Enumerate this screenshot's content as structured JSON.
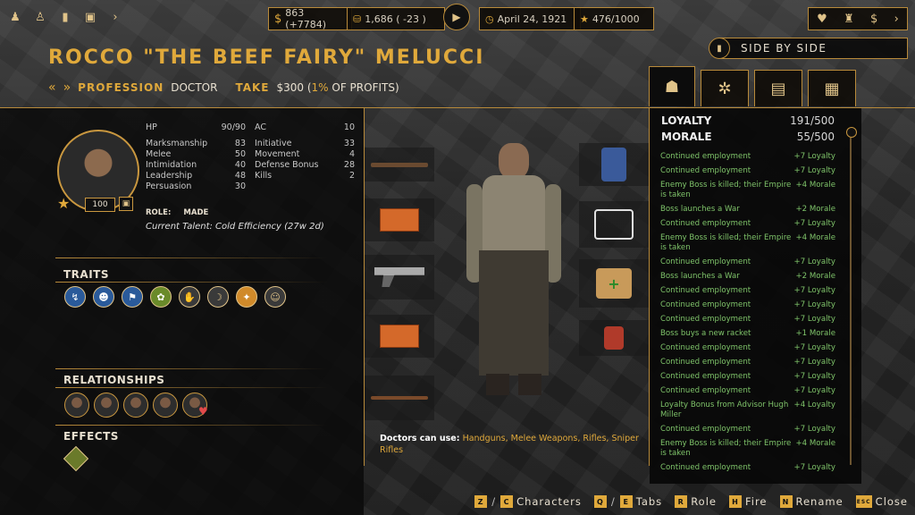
{
  "topbar": {
    "money": "863 (+7784)",
    "gang": "1,686 ( -23 )",
    "date": "April 24, 1921",
    "heat": "476/1000"
  },
  "side_by_side": "SIDE BY SIDE",
  "character": {
    "name": "ROCCO \"THE BEEF FAIRY\" MELUCCI",
    "profession_label": "PROFESSION",
    "profession": "DOCTOR",
    "take_label": "TAKE",
    "take_pre": "$300 (",
    "take_pct": "1%",
    "take_post": " OF PROFITS)",
    "level": "100",
    "role_label": "ROLE:",
    "role": "MADE",
    "talent": "Current Talent: Cold Efficiency (27w 2d)"
  },
  "stats_left": [
    {
      "label": "HP",
      "value": "90/90"
    },
    {
      "label": "Marksmanship",
      "value": "83"
    },
    {
      "label": "Melee",
      "value": "50"
    },
    {
      "label": "Intimidation",
      "value": "40"
    },
    {
      "label": "Leadership",
      "value": "48"
    },
    {
      "label": "Persuasion",
      "value": "30"
    }
  ],
  "stats_right": [
    {
      "label": "AC",
      "value": "10"
    },
    {
      "label": "Initiative",
      "value": "33"
    },
    {
      "label": "Movement",
      "value": "4"
    },
    {
      "label": "Defense Bonus",
      "value": "28"
    },
    {
      "label": "Kills",
      "value": "2"
    }
  ],
  "sections": {
    "traits": "TRAITS",
    "relationships": "RELATIONSHIPS",
    "effects": "EFFECTS"
  },
  "weapons_note": {
    "bold": "Doctors can use:",
    "list": "Handguns, Melee Weapons, Rifles, Sniper Rifles"
  },
  "loyalty": {
    "label": "LOYALTY",
    "value": "191/500"
  },
  "morale": {
    "label": "MORALE",
    "value": "55/500"
  },
  "log": [
    {
      "t": "Continued employment",
      "v": "+7 Loyalty"
    },
    {
      "t": "Continued employment",
      "v": "+7 Loyalty"
    },
    {
      "t": "Enemy Boss is killed; their Empire is taken",
      "v": "+4 Morale"
    },
    {
      "t": "Boss launches a War",
      "v": "+2 Morale"
    },
    {
      "t": "Continued employment",
      "v": "+7 Loyalty"
    },
    {
      "t": "Enemy Boss is killed; their Empire is taken",
      "v": "+4 Morale"
    },
    {
      "t": "Continued employment",
      "v": "+7 Loyalty"
    },
    {
      "t": "Boss launches a War",
      "v": "+2 Morale"
    },
    {
      "t": "Continued employment",
      "v": "+7 Loyalty"
    },
    {
      "t": "Continued employment",
      "v": "+7 Loyalty"
    },
    {
      "t": "Continued employment",
      "v": "+7 Loyalty"
    },
    {
      "t": "Boss buys a new racket",
      "v": "+1 Morale"
    },
    {
      "t": "Continued employment",
      "v": "+7 Loyalty"
    },
    {
      "t": "Continued employment",
      "v": "+7 Loyalty"
    },
    {
      "t": "Continued employment",
      "v": "+7 Loyalty"
    },
    {
      "t": "Continued employment",
      "v": "+7 Loyalty"
    },
    {
      "t": "Loyalty Bonus from Advisor Hugh Miller",
      "v": "+4 Loyalty"
    },
    {
      "t": "Continued employment",
      "v": "+7 Loyalty"
    },
    {
      "t": "Enemy Boss is killed; their Empire is taken",
      "v": "+4 Morale"
    },
    {
      "t": "Continued employment",
      "v": "+7 Loyalty"
    }
  ],
  "hints": {
    "k1": "Z",
    "k2": "C",
    "characters": "Characters",
    "k3": "Q",
    "k4": "E",
    "tabs": "Tabs",
    "k5": "R",
    "role": "Role",
    "k6": "H",
    "fire": "Fire",
    "k7": "N",
    "rename": "Rename",
    "k8": "ESC",
    "close": "Close"
  },
  "icons": {
    "top_left": [
      "boss-icon",
      "crew-icon",
      "book-icon",
      "briefcase-icon"
    ],
    "top_right": [
      "handshake-icon",
      "building-icon",
      "dollar-icon",
      "chevron-right-icon"
    ],
    "tabs": [
      "gangster-icon",
      "skill-tree-icon",
      "cards-icon",
      "ledger-icon"
    ]
  },
  "colors": {
    "accent_gold": "#e0a93b",
    "log_green": "#7fc46a"
  }
}
